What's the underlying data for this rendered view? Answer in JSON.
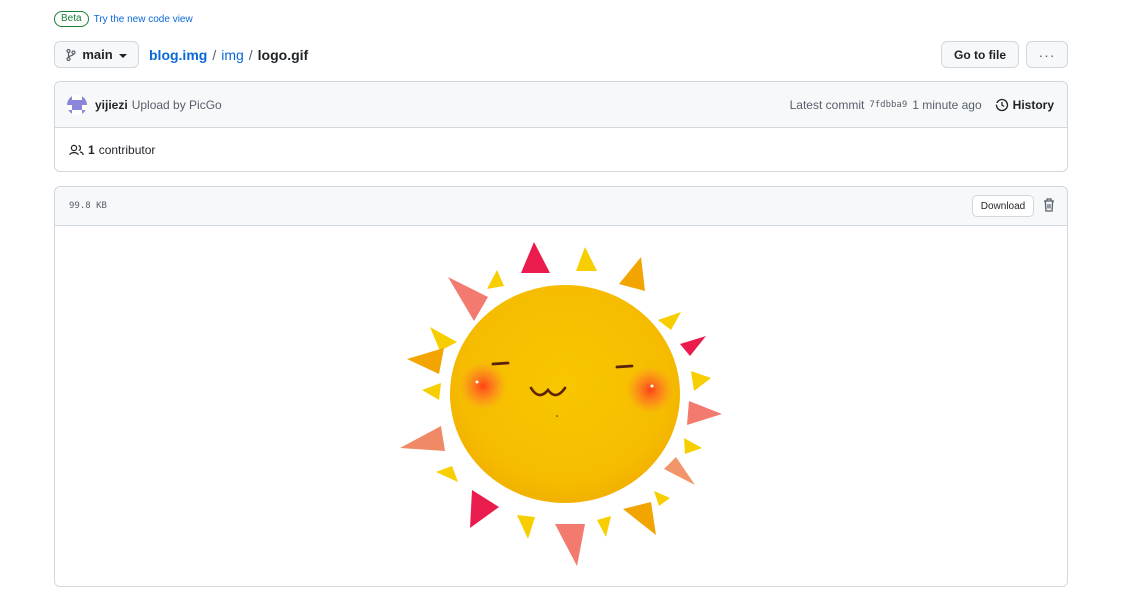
{
  "beta": {
    "badge": "Beta",
    "link": "Try the new code view"
  },
  "nav": {
    "branch": "main",
    "breadcrumb": {
      "repo": "blog.img",
      "sep1": "/",
      "dir": "img",
      "sep2": "/",
      "file": "logo.gif"
    },
    "go_to_file": "Go to file",
    "more": "···"
  },
  "commit": {
    "author": "yijiezi",
    "message": "Upload by PicGo",
    "latest_label": "Latest commit",
    "sha": "7fdbba9",
    "time": "1 minute ago",
    "history": "History",
    "contributors_count": "1",
    "contributors_label": "contributor"
  },
  "file": {
    "size": "99.8 KB",
    "download": "Download"
  },
  "icons": {
    "branch": "git-branch-icon",
    "history": "history-icon",
    "people": "people-icon",
    "trash": "trash-icon"
  },
  "colors": {
    "link": "#0969da",
    "beta": "#1a7f37",
    "sun": "#f7c200"
  }
}
